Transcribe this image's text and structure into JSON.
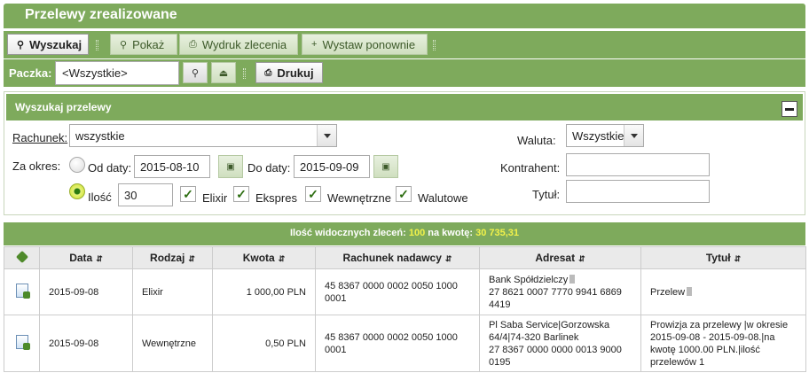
{
  "page": {
    "title": "Przelewy zrealizowane"
  },
  "toolbar": {
    "search": "Wyszukaj",
    "show": "Pokaż",
    "print_order": "Wydruk zlecenia",
    "resend": "Wystaw ponownie"
  },
  "package": {
    "label": "Paczka:",
    "value": "<Wszystkie>",
    "print": "Drukuj"
  },
  "search_panel": {
    "title": "Wyszukaj przelewy",
    "account_label": "Rachunek:",
    "account_value": "wszystkie",
    "period_label": "Za okres:",
    "from_label": "Od daty:",
    "from_value": "2015-08-10",
    "to_label": "Do daty:",
    "to_value": "2015-09-09",
    "count_label": "Ilość",
    "count_value": "30",
    "checkboxes": [
      "Elixir",
      "Ekspres",
      "Wewnętrzne",
      "Walutowe"
    ],
    "currency_label": "Waluta:",
    "currency_value": "Wszystkie",
    "contractor_label": "Kontrahent:",
    "title_label": "Tytuł:"
  },
  "summary": {
    "count_label": "Ilość widocznych zleceń:",
    "count": "100",
    "amount_label": "na kwotę:",
    "amount": "30 735,31"
  },
  "table": {
    "headers": [
      "Data",
      "Rodzaj",
      "Kwota",
      "Rachunek nadawcy",
      "Adresat",
      "Tytuł"
    ],
    "rows": [
      {
        "date": "2015-09-08",
        "type": "Elixir",
        "amount": "1 000,00 PLN",
        "sender": "45 8367 0000 0002 0050 1000 0001",
        "recipient": "Bank Spółdzielczy",
        "recipient2": "27 8621 0007 7770 9941 6869 4419",
        "title": "Przelew"
      },
      {
        "date": "2015-09-08",
        "type": "Wewnętrzne",
        "amount": "0,50 PLN",
        "sender": "45 8367 0000 0002 0050 1000 0001",
        "recipient": "Pl Saba Service|Gorzowska 64/4|74-320 Barlinek",
        "recipient2": "27 8367 0000 0000 0013 9000 0195",
        "title": "Prowizja za przelewy |w okresie 2015-09-08 - 2015-09-08.|na kwotę 1000.00 PLN.|ilość przelewów 1"
      }
    ]
  }
}
